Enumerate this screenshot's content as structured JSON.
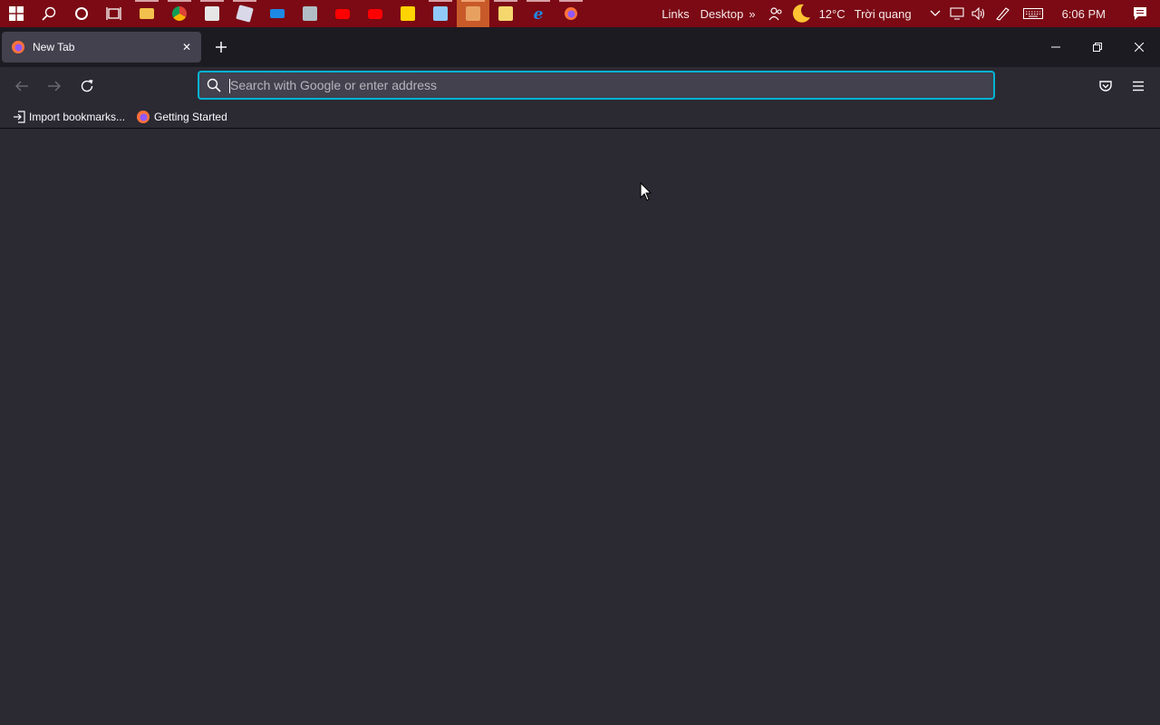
{
  "taskbar": {
    "apps": [
      {
        "name": "start-icon",
        "color": "#ffffff"
      },
      {
        "name": "search-icon",
        "color": "#ffffff"
      },
      {
        "name": "cortana-icon",
        "color": "#ffffff"
      },
      {
        "name": "task-view-icon",
        "color": "#ffffff"
      },
      {
        "name": "file-explorer-icon",
        "color": "#f2c04c"
      },
      {
        "name": "chrome-icon",
        "color": "#4caf50"
      },
      {
        "name": "store-icon",
        "color": "#e6e6e6"
      },
      {
        "name": "roblox-icon",
        "color": "#d8d8e8"
      },
      {
        "name": "remote-desktop-icon",
        "color": "#1e88e5"
      },
      {
        "name": "photos-icon",
        "color": "#b0bec5"
      },
      {
        "name": "youtube-icon",
        "color": "#ff0000"
      },
      {
        "name": "youtube-icon",
        "color": "#ff0000"
      },
      {
        "name": "sticky-notes-icon",
        "color": "#ffd400"
      },
      {
        "name": "snipping-tool-icon",
        "color": "#90caf9"
      },
      {
        "name": "app-icon",
        "color": "#e8a060"
      },
      {
        "name": "notes-app-icon",
        "color": "#f5d76e"
      },
      {
        "name": "internet-explorer-icon",
        "color": "#1e88e5"
      },
      {
        "name": "firefox-icon",
        "color": "#ff7139"
      }
    ],
    "links_label": "Links",
    "desktop_label": "Desktop",
    "overflow_label": "»",
    "weather_temp": "12°C",
    "weather_desc": "Trời quang",
    "time": "6:06 PM"
  },
  "browser": {
    "tab_title": "New Tab",
    "close_glyph": "✕",
    "urlbar_placeholder": "Search with Google or enter address",
    "bookmarks": [
      {
        "label": "Import bookmarks...",
        "icon": "import-icon"
      },
      {
        "label": "Getting Started",
        "icon": "firefox-icon"
      }
    ]
  },
  "colors": {
    "taskbar_bg": "#7b0a14",
    "content_bg": "#2b2a33",
    "focus_ring": "#00b3d4"
  }
}
